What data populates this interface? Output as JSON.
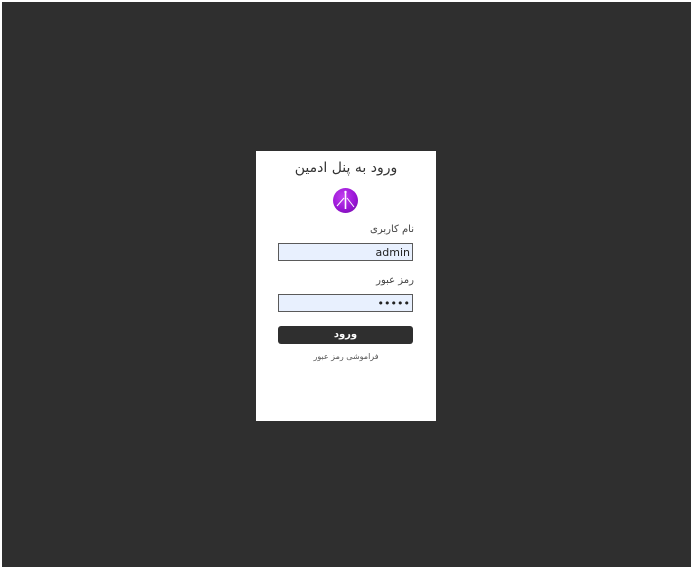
{
  "page": {
    "background_color": "#2f2f2f",
    "card_color": "#ffffff"
  },
  "login": {
    "title": "ورود به پنل ادمین",
    "logo_icon": "logo-icon",
    "logo_color": "#9a16d6",
    "username_label": "نام کاربری",
    "username_value": "admin",
    "password_label": "رمز عبور",
    "password_value": "•••••",
    "submit_label": "ورود",
    "submit_color": "#2f2f2f",
    "forgot_link": "فراموشی رمز عبور"
  }
}
